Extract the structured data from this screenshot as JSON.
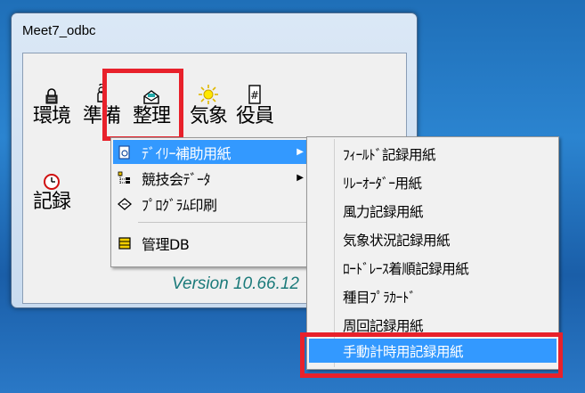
{
  "window": {
    "title": "Meet7_odbc"
  },
  "toolbar": {
    "env": "環境",
    "prepare": "準備",
    "organize": "整理",
    "weather": "気象",
    "officials": "役員",
    "record": "記録"
  },
  "version_text": "Version 10.66.12",
  "context_menu": {
    "items": [
      {
        "label": "ﾃﾞｲﾘｰ補助用紙",
        "icon": "document-icon",
        "has_submenu": true,
        "selected": true
      },
      {
        "label": "競技会ﾃﾞｰﾀ",
        "icon": "tree-icon",
        "has_submenu": true
      },
      {
        "label": "ﾌﾟﾛｸﾞﾗﾑ印刷",
        "icon": "print-diamond-icon",
        "has_submenu": false
      },
      {
        "label": "管理DB",
        "icon": "database-icon",
        "has_submenu": false
      }
    ]
  },
  "submenu": {
    "items": [
      {
        "label": "ﾌｨｰﾙﾄﾞ記録用紙"
      },
      {
        "label": "ﾘﾚｰｵｰﾀﾞｰ用紙"
      },
      {
        "label": "風力記録用紙"
      },
      {
        "label": "気象状況記録用紙"
      },
      {
        "label": "ﾛｰﾄﾞﾚｰｽ着順記録用紙"
      },
      {
        "label": "種目ﾌﾟﾗｶｰﾄﾞ"
      },
      {
        "label": "周回記録用紙"
      },
      {
        "label": "手動計時用記録用紙",
        "selected": true
      }
    ]
  },
  "colors": {
    "highlight": "#3399ff",
    "annotation": "#e8212b",
    "version": "#1b7a7a"
  }
}
